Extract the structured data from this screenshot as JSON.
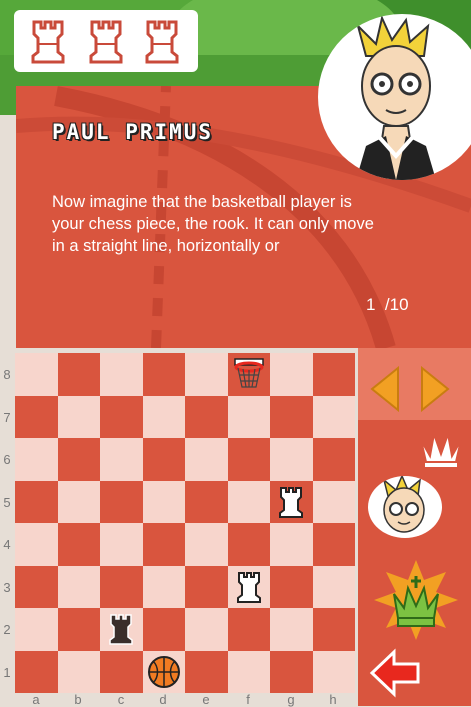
{
  "speaker": {
    "name": "PAUL PRIMUS"
  },
  "dialog": {
    "text": "Now imagine that the basketball player is your chess piece, the rook. It can only move in a straight line, horizontally or",
    "page_current": "1",
    "page_total": "/10"
  },
  "lives": {
    "count": 3,
    "icon": "rook-icon"
  },
  "board": {
    "files": [
      "a",
      "b",
      "c",
      "d",
      "e",
      "f",
      "g",
      "h"
    ],
    "ranks": [
      "8",
      "7",
      "6",
      "5",
      "4",
      "3",
      "2",
      "1"
    ],
    "pieces": [
      {
        "type": "basketball-hoop",
        "square": "f8"
      },
      {
        "type": "white-rook",
        "square": "g5"
      },
      {
        "type": "white-rook",
        "square": "f3"
      },
      {
        "type": "black-rook",
        "square": "c2"
      },
      {
        "type": "basketball",
        "square": "d1"
      }
    ]
  },
  "sidebar": {
    "nav_prev": "left-arrow-icon",
    "nav_next": "right-arrow-icon",
    "buttons": [
      "queen-icon",
      "coach-avatar",
      "king-icon",
      "back-arrow-icon"
    ]
  },
  "colors": {
    "red": "#d9553e",
    "light_square": "#f7d5cc",
    "orange": "#f2a023"
  }
}
